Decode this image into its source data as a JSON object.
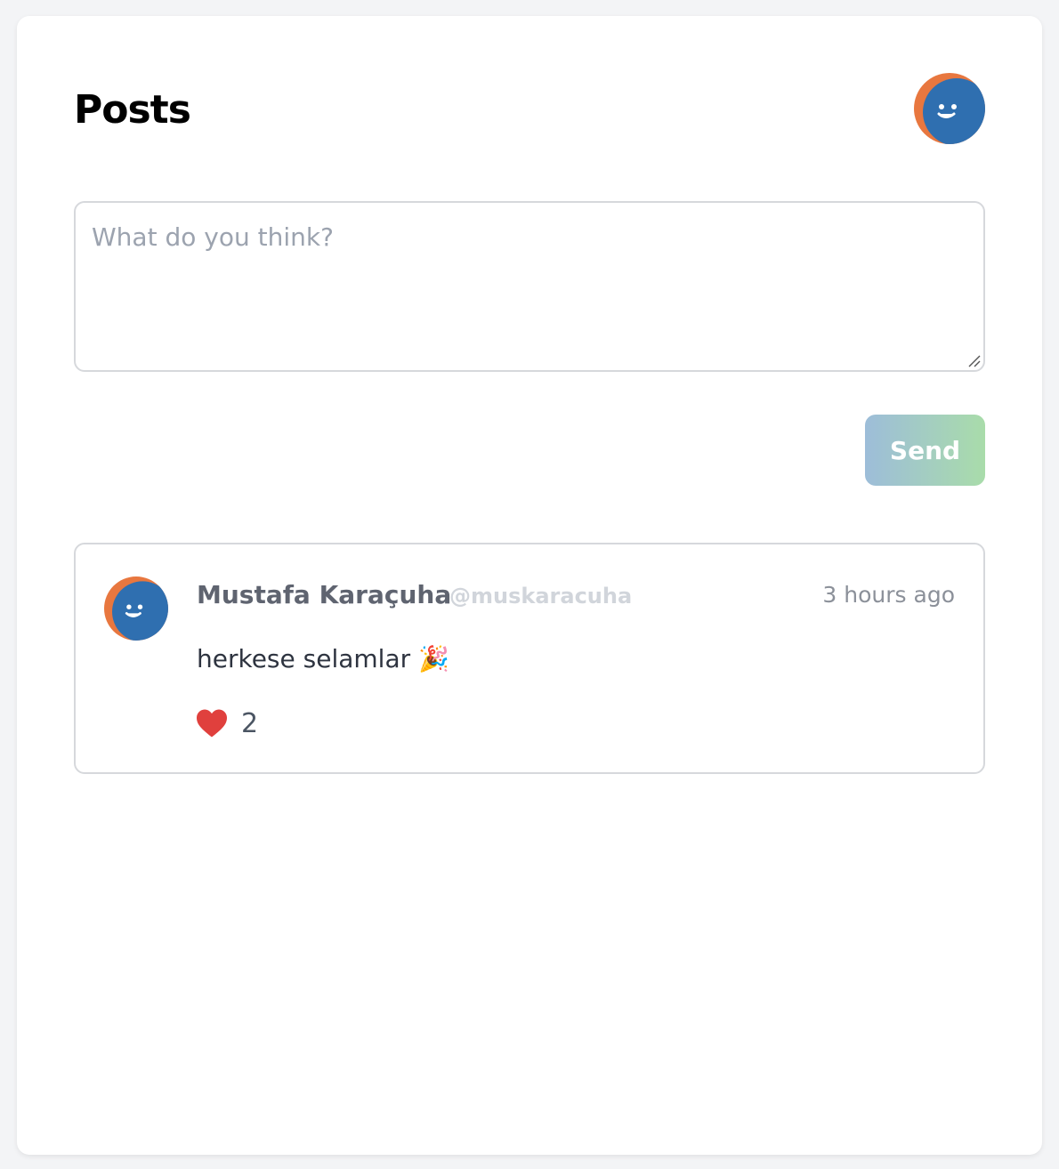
{
  "header": {
    "title": "Posts",
    "avatar_icon": "smiley-avatar-icon"
  },
  "composer": {
    "placeholder": "What do you think?",
    "value": "",
    "send_label": "Send"
  },
  "colors": {
    "avatar_orange": "#e8773f",
    "avatar_blue": "#2f6fb0",
    "send_gradient_start": "#9dbdd9",
    "send_gradient_end": "#a9dcaa",
    "heart": "#e0403d"
  },
  "posts": [
    {
      "author_name": "Mustafa Karaçuha",
      "author_handle": "@muskaracuha",
      "time": "3 hours ago",
      "body": "herkese selamlar 🎉",
      "like_icon": "heart-icon",
      "likes": "2"
    }
  ]
}
